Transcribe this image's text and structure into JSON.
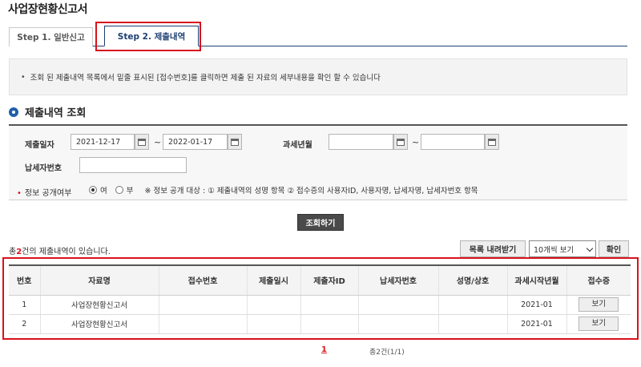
{
  "page_title": "사업장현황신고서",
  "tabs": [
    {
      "label": "Step 1. 일반신고"
    },
    {
      "label": "Step 2. 제출내역"
    }
  ],
  "notice": {
    "bullet": "•",
    "text": "조회 된 제출내역 목록에서 밑줄 표시된 [접수번호]를 클릭하면 제출 된 자료의 세부내용을 확인 할 수 있습니다"
  },
  "section_title": "제출내역 조회",
  "search": {
    "submit_date_label": "제출일자",
    "submit_date_from": "2021-12-17",
    "submit_date_to": "2022-01-17",
    "tilde": "~",
    "tax_period_label": "과세년월",
    "tax_period_from": "",
    "tax_period_to": "",
    "taxpayer_no_label": "납세자번호",
    "taxpayer_no_value": "",
    "disclosure_label": "정보 공개여부",
    "required_mark": "•",
    "option_yes": "여",
    "option_no": "부",
    "disclosure_note": "※ 정보 공개 대상 : ① 제출내역의 성명 항목 ② 접수증의 사용자ID, 사용자명, 납세자명, 납세자번호 항목"
  },
  "query_button": "조회하기",
  "results": {
    "count_prefix": "총",
    "count": "2",
    "count_suffix": "건의 제출내역이 있습니다.",
    "download_button": "목록 내려받기",
    "page_size_selected": "10개씩 보기",
    "confirm_button": "확인"
  },
  "table": {
    "headers": [
      "번호",
      "자료명",
      "접수번호",
      "제출일시",
      "제출자ID",
      "납세자번호",
      "성명/상호",
      "과세시작년월",
      "접수증"
    ],
    "rows": [
      {
        "no": "1",
        "name": "사업장현황신고서",
        "receipt_no": "",
        "submitted_at": "",
        "submitter_id": "",
        "taxpayer_no": "",
        "person_name": "",
        "tax_start": "2021-01",
        "action": "보기"
      },
      {
        "no": "2",
        "name": "사업장현황신고서",
        "receipt_no": "",
        "submitted_at": "",
        "submitter_id": "",
        "taxpayer_no": "",
        "person_name": "",
        "tax_start": "2021-01",
        "action": "보기"
      }
    ]
  },
  "pagination": {
    "current_page": "1",
    "total_text": "총2건(1/1)"
  },
  "colors": {
    "highlight_red": "#d9121c",
    "navy": "#1c3f73",
    "bullet_blue": "#1f5fa8",
    "button_dark": "#4a4a4a"
  }
}
